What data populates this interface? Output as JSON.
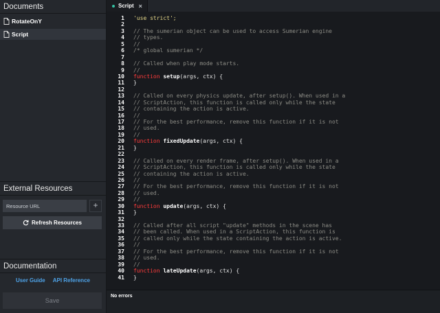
{
  "documents": {
    "title": "Documents",
    "items": [
      {
        "name": "RotateOnY",
        "selected": false
      },
      {
        "name": "Script",
        "selected": true
      }
    ]
  },
  "external_resources": {
    "title": "External Resources",
    "url_placeholder": "Resource URL",
    "add_label": "+",
    "refresh_label": "Refresh Resources"
  },
  "documentation": {
    "title": "Documentation",
    "user_guide": "User Guide",
    "api_reference": "API Reference",
    "save_label": "Save"
  },
  "editor": {
    "tab_label": "Script",
    "tab_close": "×",
    "status": "No errors",
    "lines": [
      {
        "n": "1",
        "type": "st",
        "text": "'use strict';"
      },
      {
        "n": "2",
        "type": "cm",
        "text": ""
      },
      {
        "n": "3",
        "type": "cm",
        "text": "// The sumerian object can be used to access Sumerian engine"
      },
      {
        "n": "4",
        "type": "cm",
        "text": "// types."
      },
      {
        "n": "5",
        "type": "cm",
        "text": "//"
      },
      {
        "n": "6",
        "type": "cm",
        "text": "/* global sumerian */"
      },
      {
        "n": "7",
        "type": "cm",
        "text": ""
      },
      {
        "n": "8",
        "type": "cm",
        "text": "// Called when play mode starts."
      },
      {
        "n": "9",
        "type": "cm",
        "text": "//"
      },
      {
        "n": "10",
        "type": "fn",
        "kw": "function",
        "name": "setup",
        "args": "(args, ctx) {"
      },
      {
        "n": "11",
        "type": "fn",
        "text": "}"
      },
      {
        "n": "12",
        "type": "cm",
        "text": ""
      },
      {
        "n": "13",
        "type": "cm",
        "text": "// Called on every physics update, after setup(). When used in a"
      },
      {
        "n": "14",
        "type": "cm",
        "text": "// ScriptAction, this function is called only while the state"
      },
      {
        "n": "15",
        "type": "cm",
        "text": "// containing the action is active."
      },
      {
        "n": "16",
        "type": "cm",
        "text": "//"
      },
      {
        "n": "17",
        "type": "cm",
        "text": "// For the best performance, remove this function if it is not"
      },
      {
        "n": "18",
        "type": "cm",
        "text": "// used."
      },
      {
        "n": "19",
        "type": "cm",
        "text": "//"
      },
      {
        "n": "20",
        "type": "fn",
        "kw": "function",
        "name": "fixedUpdate",
        "args": "(args, ctx) {"
      },
      {
        "n": "21",
        "type": "fn",
        "text": "}"
      },
      {
        "n": "22",
        "type": "cm",
        "text": ""
      },
      {
        "n": "23",
        "type": "cm",
        "text": "// Called on every render frame, after setup(). When used in a"
      },
      {
        "n": "24",
        "type": "cm",
        "text": "// ScriptAction, this function is called only while the state"
      },
      {
        "n": "25",
        "type": "cm",
        "text": "// containing the action is active."
      },
      {
        "n": "26",
        "type": "cm",
        "text": "//"
      },
      {
        "n": "27",
        "type": "cm",
        "text": "// For the best performance, remove this function if it is not"
      },
      {
        "n": "28",
        "type": "cm",
        "text": "// used."
      },
      {
        "n": "29",
        "type": "cm",
        "text": "//"
      },
      {
        "n": "30",
        "type": "fn",
        "kw": "function",
        "name": "update",
        "args": "(args, ctx) {"
      },
      {
        "n": "31",
        "type": "fn",
        "text": "}"
      },
      {
        "n": "32",
        "type": "cm",
        "text": ""
      },
      {
        "n": "33",
        "type": "cm",
        "text": "// Called after all script \"update\" methods in the scene has"
      },
      {
        "n": "34",
        "type": "cm",
        "text": "// been called. When used in a ScriptAction, this function is"
      },
      {
        "n": "35",
        "type": "cm",
        "text": "// called only while the state containing the action is active."
      },
      {
        "n": "36",
        "type": "cm",
        "text": "//"
      },
      {
        "n": "37",
        "type": "cm",
        "text": "// For the best performance, remove this function if it is not"
      },
      {
        "n": "38",
        "type": "cm",
        "text": "// used."
      },
      {
        "n": "39",
        "type": "cm",
        "text": "//"
      },
      {
        "n": "40",
        "type": "fn",
        "kw": "function",
        "name": "lateUpdate",
        "args": "(args, ctx) {"
      },
      {
        "n": "41",
        "type": "fn",
        "text": "}"
      }
    ]
  }
}
